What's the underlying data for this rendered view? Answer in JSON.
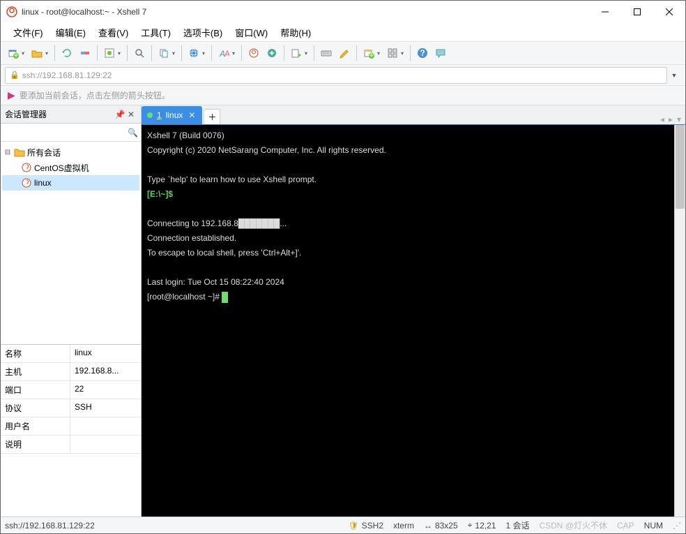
{
  "window": {
    "title": "linux - root@localhost:~ - Xshell 7"
  },
  "menu": {
    "file": "文件(F)",
    "edit": "编辑(E)",
    "view": "查看(V)",
    "tools": "工具(T)",
    "tabs": "选项卡(B)",
    "window": "窗口(W)",
    "help": "帮助(H)"
  },
  "address": {
    "url": "ssh://192.168.81.129:22"
  },
  "tip": {
    "text": "要添加当前会话，点击左侧的箭头按钮。"
  },
  "sidebar": {
    "title": "会话管理器",
    "root": "所有会话",
    "items": [
      "CentOS虚拟机",
      "linux"
    ],
    "selected": 1
  },
  "props": {
    "rows": [
      {
        "k": "名称",
        "v": "linux"
      },
      {
        "k": "主机",
        "v": "192.168.8..."
      },
      {
        "k": "端口",
        "v": "22"
      },
      {
        "k": "协议",
        "v": "SSH"
      },
      {
        "k": "用户名",
        "v": ""
      },
      {
        "k": "说明",
        "v": ""
      }
    ]
  },
  "tab": {
    "num": "1",
    "name": "linux"
  },
  "terminal": {
    "l1": "Xshell 7 (Build 0076)",
    "l2": "Copyright (c) 2020 NetSarang Computer, Inc. All rights reserved.",
    "l3": "",
    "l4": "Type `help' to learn how to use Xshell prompt.",
    "prompt": "[E:\\~]$",
    "l6": "",
    "l7": "Connecting to 192.168.8███████...",
    "l8": "Connection established.",
    "l9": "To escape to local shell, press 'Ctrl+Alt+]'.",
    "l10": "",
    "l11": "Last login: Tue Oct 15 08:22:40 2024",
    "l12": "[root@localhost ~]# "
  },
  "status": {
    "addr": "ssh://192.168.81.129:22",
    "proto": "SSH2",
    "term": "xterm",
    "size": "83x25",
    "pos": "12,21",
    "sessions": "1 会话",
    "watermark": "CSDN @灯火不休",
    "cap": "CAP",
    "num": "NUM"
  }
}
